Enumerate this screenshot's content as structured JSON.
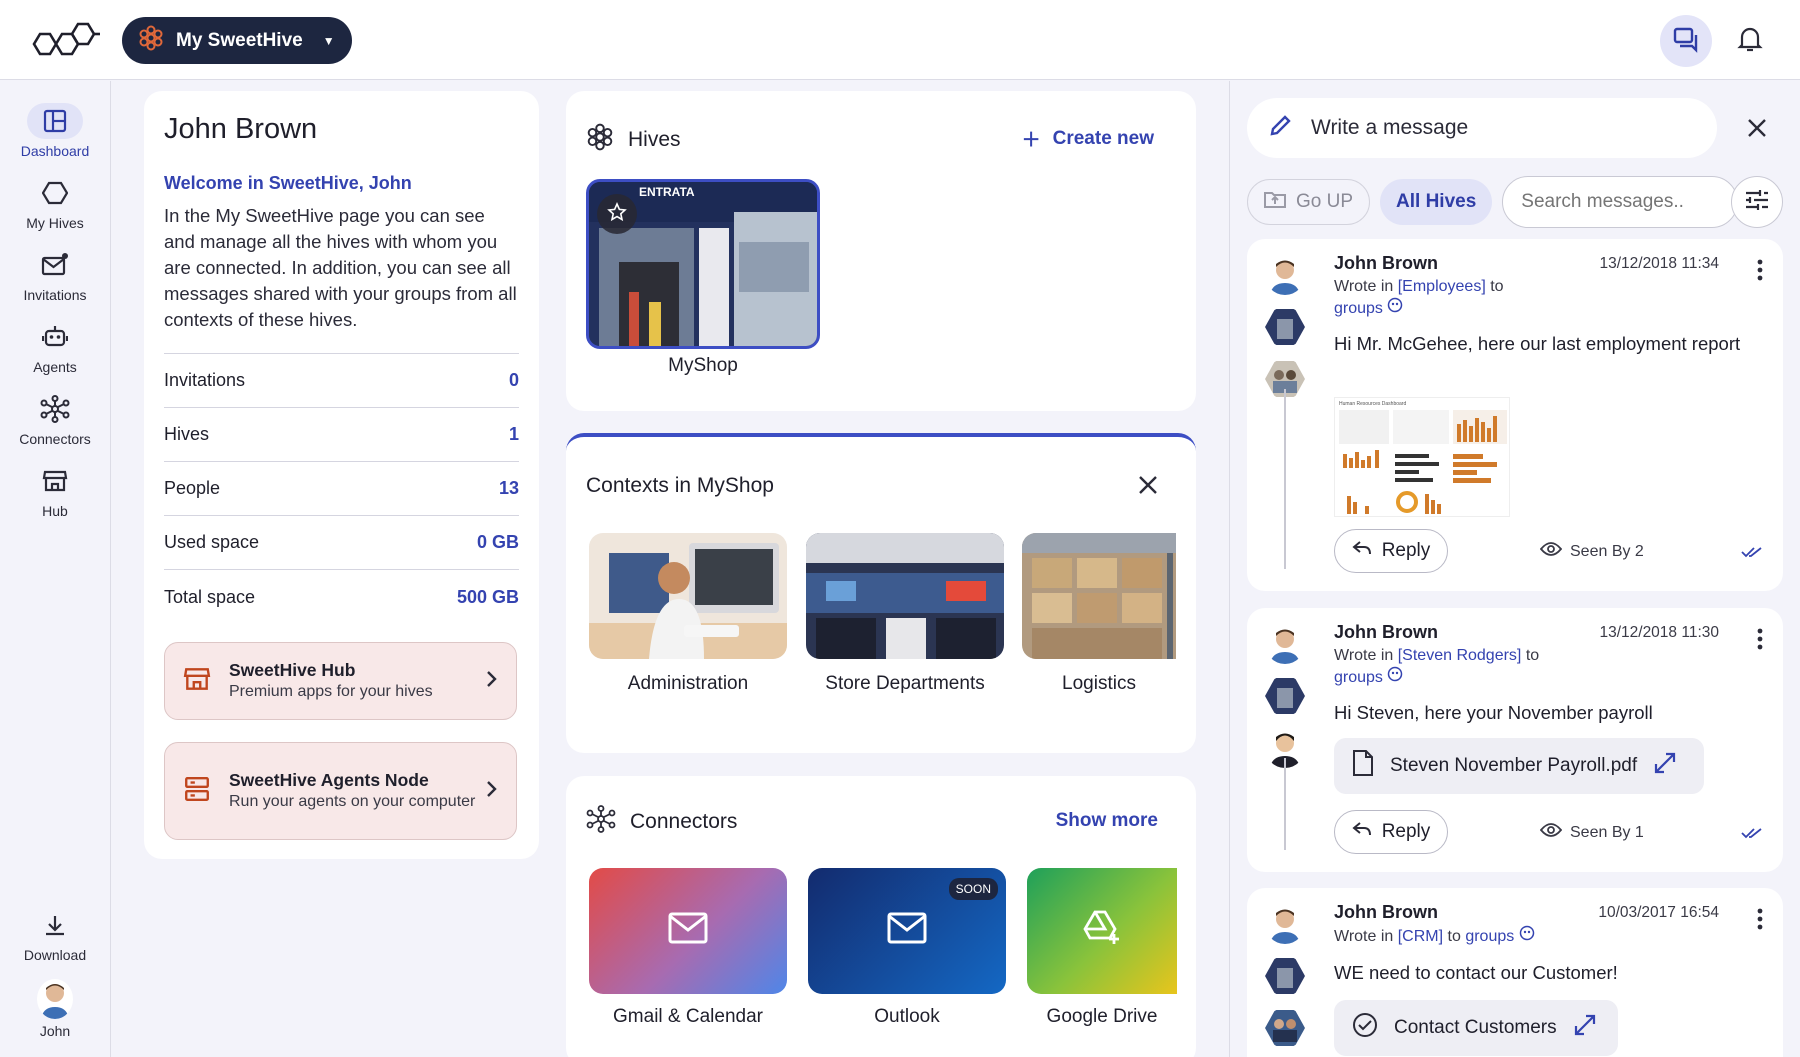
{
  "header": {
    "hive_selector": "My SweetHive"
  },
  "sidebar": {
    "items": [
      {
        "label": "Dashboard"
      },
      {
        "label": "My Hives"
      },
      {
        "label": "Invitations"
      },
      {
        "label": "Agents"
      },
      {
        "label": "Connectors"
      },
      {
        "label": "Hub"
      }
    ],
    "download": "Download",
    "user": "John"
  },
  "profile": {
    "name": "John Brown",
    "welcome": "Welcome in SweetHive, John",
    "description": "In the My SweetHive page you can see and manage all the hives with whom you are connected. In addition, you can see all messages shared with your groups from all contexts of these hives.",
    "stats": [
      {
        "label": "Invitations",
        "value": "0"
      },
      {
        "label": "Hives",
        "value": "1"
      },
      {
        "label": "People",
        "value": "13"
      },
      {
        "label": "Used space",
        "value": "0 GB"
      },
      {
        "label": "Total space",
        "value": "500 GB"
      }
    ],
    "promos": [
      {
        "title": "SweetHive Hub",
        "subtitle": "Premium apps for your hives"
      },
      {
        "title": "SweetHive Agents Node",
        "subtitle": "Run your agents on your computer"
      }
    ]
  },
  "hives": {
    "title": "Hives",
    "create_label": "Create new",
    "items": [
      {
        "name": "MyShop",
        "sign": "ENTRATA"
      }
    ]
  },
  "contexts": {
    "title": "Contexts in MyShop",
    "items": [
      {
        "name": "Administration"
      },
      {
        "name": "Store Departments"
      },
      {
        "name": "Logistics"
      }
    ]
  },
  "connectors": {
    "title": "Connectors",
    "show_more": "Show more",
    "items": [
      {
        "name": "Gmail & Calendar"
      },
      {
        "name": "Outlook",
        "badge": "SOON"
      },
      {
        "name": "Google Drive"
      }
    ]
  },
  "messages_panel": {
    "write_placeholder": "Write a message",
    "go_up": "Go UP",
    "all_hives": "All Hives",
    "search_placeholder": "Search messages..",
    "messages": [
      {
        "author": "John Brown",
        "date": "13/12/2018 11:34",
        "wrote_in": "Wrote in",
        "context": "[Employees]",
        "to": "to",
        "target": "groups",
        "text": "Hi Mr. McGehee, here our last employment report",
        "reply": "Reply",
        "seen": "Seen By 2",
        "thumb_title": "Human Resources Dashboard"
      },
      {
        "author": "John Brown",
        "date": "13/12/2018 11:30",
        "wrote_in": "Wrote in",
        "context": "[Steven Rodgers]",
        "to": "to",
        "target": "groups",
        "text": "Hi Steven, here your November payroll",
        "attachment": "Steven November Payroll.pdf",
        "reply": "Reply",
        "seen": "Seen By 1"
      },
      {
        "author": "John Brown",
        "date": "10/03/2017 16:54",
        "wrote_in": "Wrote in",
        "context": "[CRM]",
        "to": "to",
        "target": "groups",
        "text": "WE need to contact our Customer!",
        "attachment": "Contact Customers"
      }
    ]
  },
  "colors": {
    "accent": "#3443b0",
    "dark": "#1d2640",
    "promo_bg": "#f8e8e8",
    "icon_orange": "#c0461e"
  }
}
